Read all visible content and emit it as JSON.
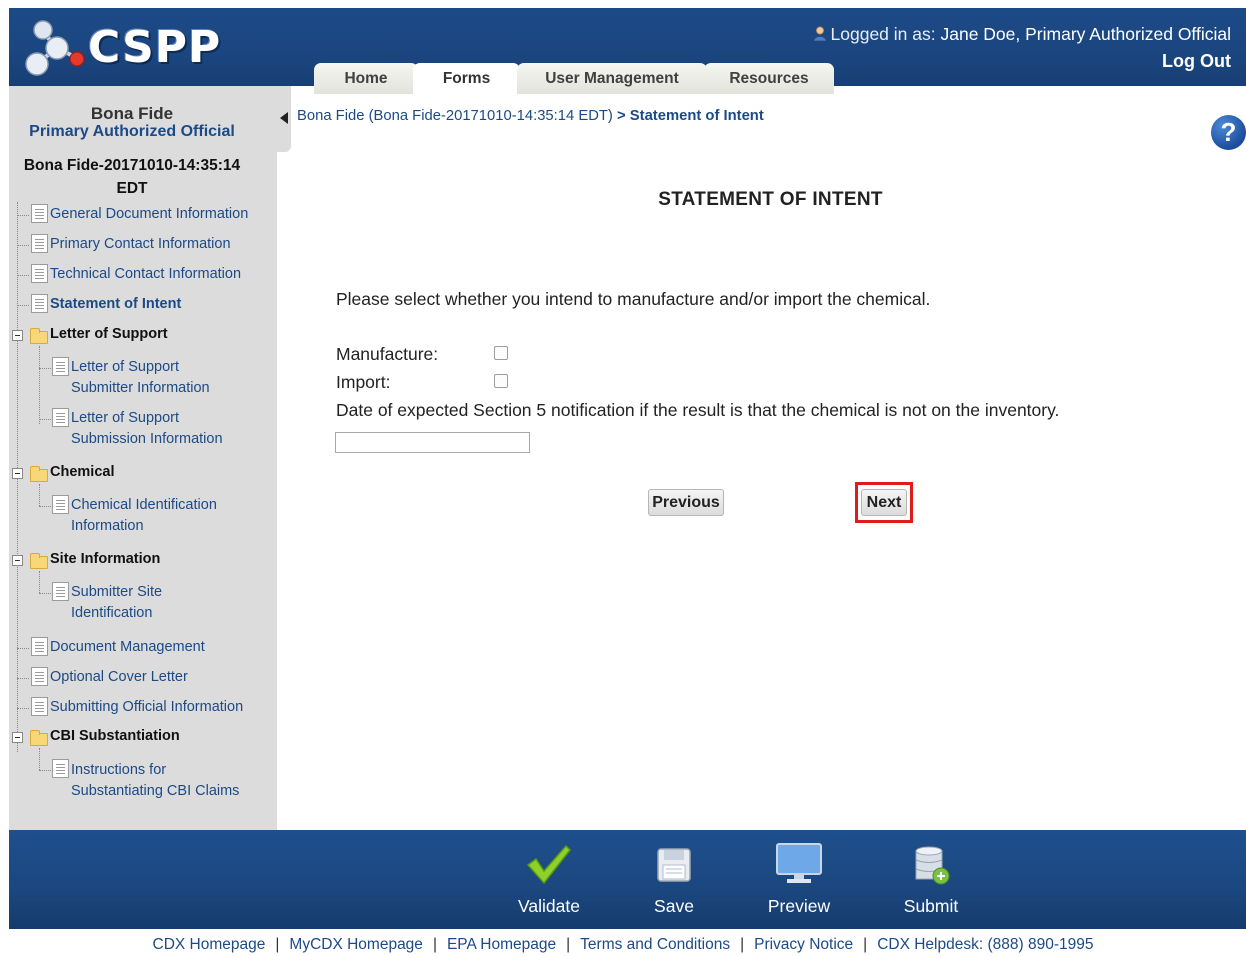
{
  "header": {
    "app_name": "CSPP",
    "logged_in_prefix": "Logged in as:",
    "user": "Jane Doe, Primary Authorized Official",
    "logout": "Log Out",
    "tabs": [
      {
        "label": "Home",
        "active": false
      },
      {
        "label": "Forms",
        "active": true
      },
      {
        "label": "User Management",
        "active": false
      },
      {
        "label": "Resources",
        "active": false
      }
    ],
    "colors": {
      "bar": "#1c4a86",
      "tab": "#ecece6"
    }
  },
  "sidebar": {
    "title": "Bona Fide",
    "subtitle": "Primary Authorized Official",
    "document_id": "Bona Fide-20171010-14:35:14 EDT",
    "items": [
      {
        "label": "General Document Information"
      },
      {
        "label": "Primary Contact Information"
      },
      {
        "label": "Technical Contact Information"
      },
      {
        "label": "Statement of Intent",
        "current": true
      }
    ],
    "groups": [
      {
        "label": "Letter of Support",
        "children": [
          {
            "line1": "Letter of Support",
            "line2": "Submitter Information"
          },
          {
            "line1": "Letter of Support",
            "line2": "Submission Information"
          }
        ]
      },
      {
        "label": "Chemical",
        "children": [
          {
            "line1": "Chemical Identification",
            "line2": "Information"
          }
        ]
      },
      {
        "label": "Site Information",
        "children": [
          {
            "line1": "Submitter Site",
            "line2": "Identification"
          }
        ]
      }
    ],
    "more_items": [
      {
        "label": "Document Management"
      },
      {
        "label": "Optional Cover Letter"
      },
      {
        "label": "Submitting Official Information"
      }
    ],
    "cbi_group": {
      "label": "CBI Substantiation",
      "children": [
        {
          "line1": "Instructions for",
          "line2": "Substantiating CBI Claims"
        }
      ]
    }
  },
  "breadcrumb": {
    "parent": "Bona Fide (Bona Fide-20171010-14:35:14 EDT)",
    "separator": ">",
    "current": "Statement of Intent"
  },
  "main": {
    "title": "STATEMENT OF INTENT",
    "instructions": "Please select whether you intend to manufacture and/or import the chemical.",
    "manufacture_label": "Manufacture:",
    "manufacture_checked": false,
    "import_label": "Import:",
    "import_checked": false,
    "date_label": "Date of expected Section 5 notification if the result is that the chemical is not on the inventory.",
    "date_value": "",
    "previous_label": "Previous",
    "next_label": "Next",
    "highlight_color": "#e01b1b"
  },
  "toolbar": {
    "items": [
      {
        "label": "Validate",
        "icon": "checkmark-icon"
      },
      {
        "label": "Save",
        "icon": "save-icon"
      },
      {
        "label": "Preview",
        "icon": "monitor-icon"
      },
      {
        "label": "Submit",
        "icon": "database-icon"
      }
    ]
  },
  "footer": {
    "links": [
      "CDX Homepage",
      "MyCDX Homepage",
      "EPA Homepage",
      "Terms and Conditions",
      "Privacy Notice",
      "CDX Helpdesk: (888) 890-1995"
    ],
    "separator": "|"
  }
}
